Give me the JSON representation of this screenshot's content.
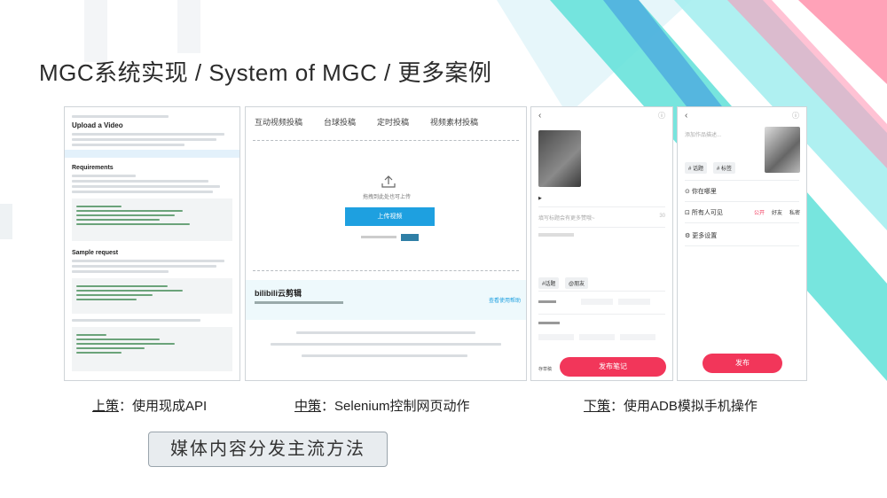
{
  "slide": {
    "title": "MGC系统实现 / System of MGC / 更多案例",
    "colors": {
      "accent_teal": "#5fe0d8",
      "accent_blue": "#3a8fe0",
      "accent_pink": "#f2365a",
      "upload_blue": "#1ea0e0"
    }
  },
  "panel_api": {
    "heading": "Upload a Video",
    "section_requirements": "Requirements",
    "section_sample": "Sample request"
  },
  "panel_selenium": {
    "tabs": [
      "互动视频投稿",
      "台球投稿",
      "定时投稿",
      "视频素材投稿"
    ],
    "upload_hint": "拖拽到此处也可上传",
    "upload_button": "上传视频",
    "brand": "bilibili云剪辑",
    "help_link": "查看使用帮助"
  },
  "phone_left": {
    "title_placeholder": "填写标题会有更多赞哦~",
    "counter": "30",
    "tags": [
      "#话题",
      "@朋友"
    ],
    "publish_button": "发布笔记",
    "draft_label": "存草稿"
  },
  "phone_right": {
    "desc_placeholder": "添加作品描述...",
    "chip_1": "# 话题",
    "chip_2": "# 标签",
    "location": "你在哪里",
    "visibility_label": "所有人可见",
    "visibility_opts": [
      "公开",
      "好友",
      "私密"
    ],
    "more_settings": "更多设置",
    "publish_button": "发布"
  },
  "captions": {
    "top_key": "上策",
    "top_rest": "：使用现成API",
    "mid_key": "中策",
    "mid_rest": "：Selenium控制网页动作",
    "low_key": "下策",
    "low_rest": "：使用ADB模拟手机操作"
  },
  "summary_box": "媒体内容分发主流方法"
}
